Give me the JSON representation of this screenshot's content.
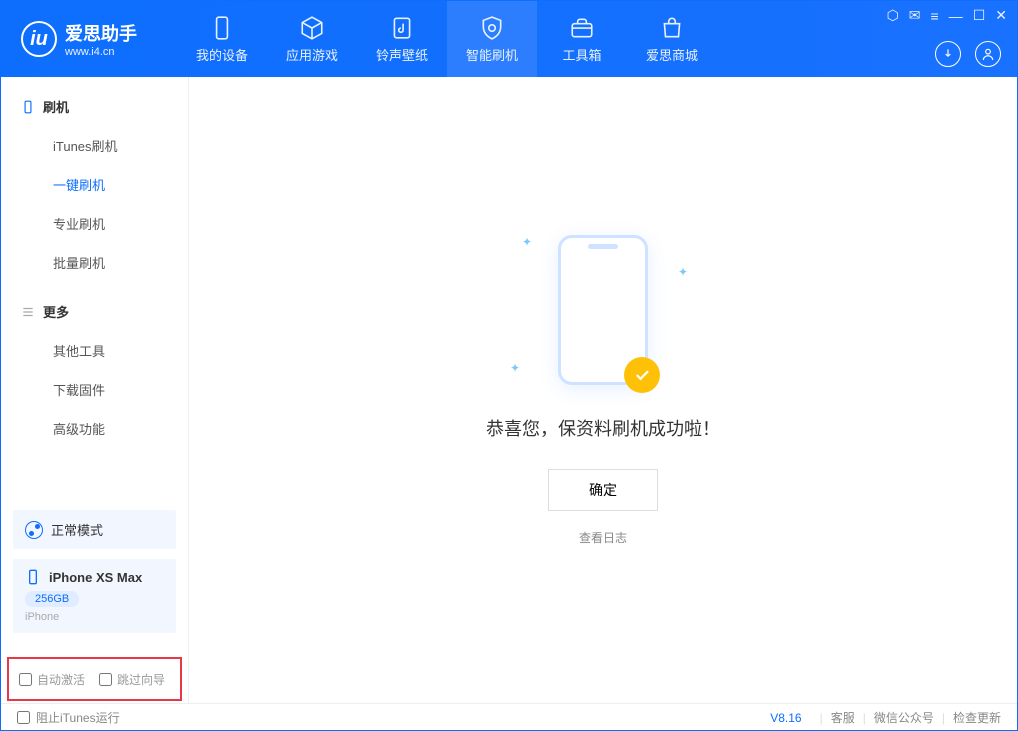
{
  "app": {
    "title": "爱思助手",
    "subtitle": "www.i4.cn"
  },
  "nav": {
    "tabs": [
      {
        "label": "我的设备"
      },
      {
        "label": "应用游戏"
      },
      {
        "label": "铃声壁纸"
      },
      {
        "label": "智能刷机"
      },
      {
        "label": "工具箱"
      },
      {
        "label": "爱思商城"
      }
    ]
  },
  "sidebar": {
    "section1": {
      "title": "刷机",
      "items": [
        {
          "label": "iTunes刷机"
        },
        {
          "label": "一键刷机"
        },
        {
          "label": "专业刷机"
        },
        {
          "label": "批量刷机"
        }
      ]
    },
    "section2": {
      "title": "更多",
      "items": [
        {
          "label": "其他工具"
        },
        {
          "label": "下载固件"
        },
        {
          "label": "高级功能"
        }
      ]
    },
    "mode": "正常模式",
    "device": {
      "name": "iPhone XS Max",
      "storage": "256GB",
      "type": "iPhone"
    },
    "check1": "自动激活",
    "check2": "跳过向导"
  },
  "content": {
    "success": "恭喜您，保资料刷机成功啦！",
    "confirm": "确定",
    "view_log": "查看日志"
  },
  "statusbar": {
    "block_itunes": "阻止iTunes运行",
    "version": "V8.16",
    "link1": "客服",
    "link2": "微信公众号",
    "link3": "检查更新"
  }
}
